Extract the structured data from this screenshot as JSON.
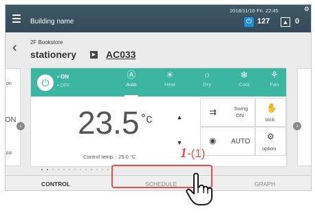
{
  "header": {
    "building_name": "Building name",
    "datetime": "2018/11/16 Fri. 22:45",
    "power_count": "127",
    "alert_count": "0"
  },
  "location": {
    "floor_area": "2F Bookstore",
    "group": "stationery",
    "unit": "AC033"
  },
  "power": {
    "on_label": "• ON",
    "off_label": "• OFF"
  },
  "modes": [
    {
      "label": "Auto",
      "icon": "Ⓐ"
    },
    {
      "label": "Heat",
      "icon": "☀"
    },
    {
      "label": "Dry",
      "icon": "○"
    },
    {
      "label": "Cool",
      "icon": "❄"
    },
    {
      "label": "Fan",
      "icon": "⚘"
    }
  ],
  "temperature": {
    "value": "23.5",
    "unit": "°c",
    "control_label": "Control temp. : 25.0 °C"
  },
  "buttons": {
    "swing_top": "Swing",
    "swing_bottom": "ON",
    "lock": "lock",
    "auto": "AUTO",
    "option": "option"
  },
  "left_peek": {
    "top": "on",
    "middle": "ON",
    "bottom": "FF"
  },
  "nav": {
    "control": "CONTROL",
    "schedule": "SCHEDULE",
    "graph": "GRAPH"
  },
  "annotation": {
    "number": "1",
    "step": "-(1)"
  },
  "colors": {
    "header": "#3f5966",
    "accent": "#3cb6a3",
    "highlight": "#d9534f"
  }
}
